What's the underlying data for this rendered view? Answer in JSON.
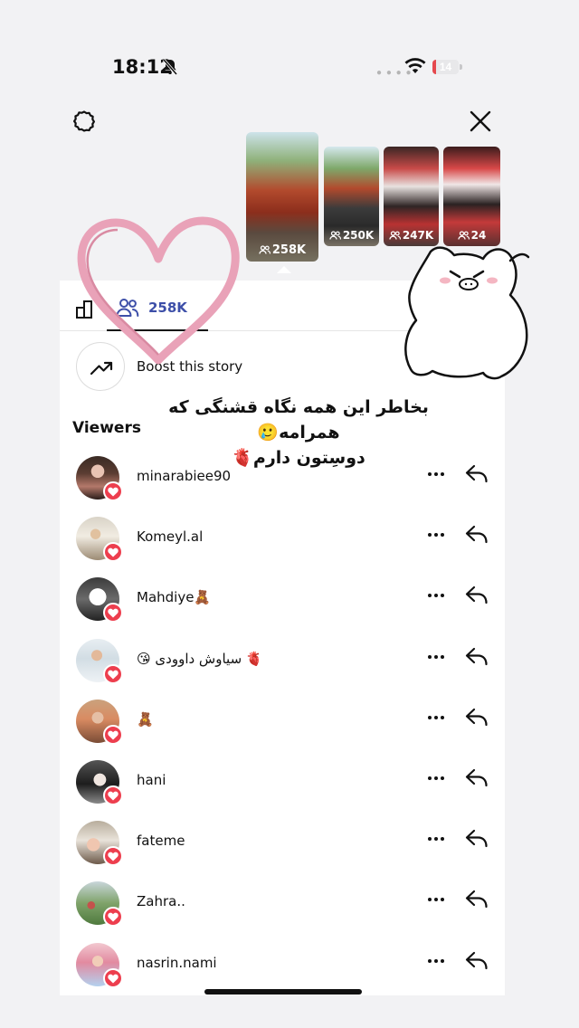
{
  "status_bar": {
    "time": "18:12",
    "battery_level": "14",
    "battery_fraction": 0.14
  },
  "header": {
    "settings_icon": "gear-icon",
    "close_icon": "close-icon"
  },
  "story_thumbnails": [
    {
      "views": "258K",
      "selected": true
    },
    {
      "views": "250K",
      "selected": false
    },
    {
      "views": "247K",
      "selected": false
    },
    {
      "views": "24",
      "selected": false
    }
  ],
  "tabs": {
    "viewers_count": "258K"
  },
  "boost": {
    "label": "Boost this story"
  },
  "viewers": {
    "title": "Viewers",
    "list": [
      {
        "username": "minarabiee90",
        "liked": true
      },
      {
        "username": "Komeyl.al",
        "liked": true
      },
      {
        "username": "Mahdiye🧸",
        "liked": true
      },
      {
        "username": "😘 سیاوش داوودی 🫀",
        "liked": true
      },
      {
        "username": "🧸",
        "liked": true
      },
      {
        "username": "hani",
        "liked": true
      },
      {
        "username": "fateme",
        "liked": true
      },
      {
        "username": "Zahra..",
        "liked": true
      },
      {
        "username": "nasrin.nami",
        "liked": true
      }
    ]
  },
  "overlay": {
    "line1": "بخاطر این همه نگاه قشنگی که همرامه🥲",
    "line2": "دوسِتون دارم🫀"
  },
  "colors": {
    "accent": "#3d4fa8",
    "like": "#ed3e4e",
    "sticker_pink": "#e9a2b8"
  }
}
